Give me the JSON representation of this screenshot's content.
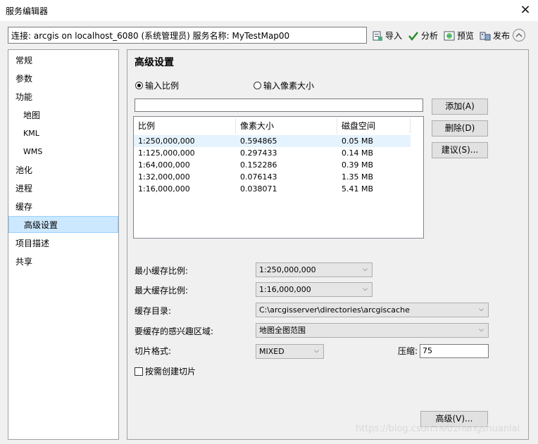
{
  "window": {
    "title": "服务编辑器",
    "close_icon": "×"
  },
  "toolbar": {
    "connection_text": "连接: arcgis on localhost_6080 (系统管理员)   服务名称: MyTestMap00",
    "import_label": "导入",
    "analyze_label": "分析",
    "preview_label": "预览",
    "publish_label": "发布",
    "collapse_icon": "^"
  },
  "sidebar": {
    "items": [
      {
        "label": "常规"
      },
      {
        "label": "参数"
      },
      {
        "label": "功能"
      },
      {
        "label": "地图"
      },
      {
        "label": "KML"
      },
      {
        "label": "WMS"
      },
      {
        "label": "池化"
      },
      {
        "label": "进程"
      },
      {
        "label": "缓存"
      },
      {
        "label": "高级设置"
      },
      {
        "label": "项目描述"
      },
      {
        "label": "共享"
      }
    ],
    "selected": "高级设置"
  },
  "panel": {
    "heading": "高级设置",
    "radio_scale": "输入比例",
    "radio_pixel": "输入像素大小",
    "scale_input_value": "",
    "add_button": "添加(A)",
    "delete_button": "删除(D)",
    "suggest_button": "建议(S)...",
    "table": {
      "headers": [
        "比例",
        "像素大小",
        "磁盘空间"
      ],
      "rows": [
        [
          "1:250,000,000",
          "0.594865",
          "0.05 MB"
        ],
        [
          "1:125,000,000",
          "0.297433",
          "0.14 MB"
        ],
        [
          "1:64,000,000",
          "0.152286",
          "0.39 MB"
        ],
        [
          "1:32,000,000",
          "0.076143",
          "1.35 MB"
        ],
        [
          "1:16,000,000",
          "0.038071",
          "5.41 MB"
        ]
      ]
    },
    "min_scale_label": "最小缓存比例:",
    "min_scale_value": "1:250,000,000",
    "max_scale_label": "最大缓存比例:",
    "max_scale_value": "1:16,000,000",
    "cache_dir_label": "缓存目录:",
    "cache_dir_value": "C:\\arcgisserver\\directories\\arcgiscache",
    "aoi_label": "要缓存的感兴趣区域:",
    "aoi_value": "地图全图范围",
    "tile_format_label": "切片格式:",
    "tile_format_value": "MIXED",
    "compression_label": "压缩:",
    "compression_value": "75",
    "on_demand_label": "按需创建切片",
    "advanced_button": "高级(V)..."
  },
  "watermark": "https://blog.csdn.net/zhangshuanlai"
}
